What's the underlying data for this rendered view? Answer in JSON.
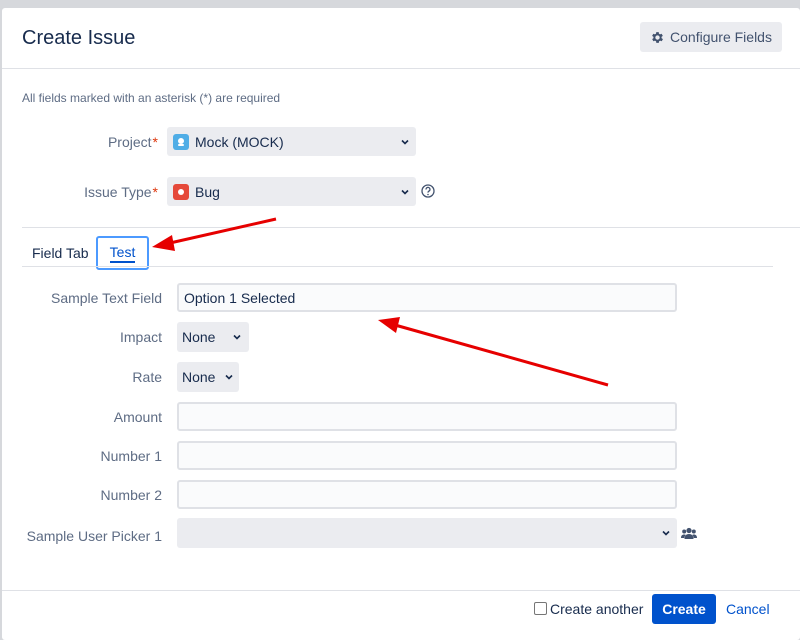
{
  "dialog": {
    "title": "Create Issue",
    "configure_label": "Configure Fields",
    "required_note": "All fields marked with an asterisk (*) are required"
  },
  "project": {
    "label": "Project",
    "required": "*",
    "value": "Mock (MOCK)"
  },
  "issue_type": {
    "label": "Issue Type",
    "required": "*",
    "value": "Bug"
  },
  "tabs": [
    {
      "label": "Field Tab"
    },
    {
      "label": "Test"
    }
  ],
  "fields": {
    "sample_text": {
      "label": "Sample Text Field",
      "value": "Option 1 Selected"
    },
    "impact": {
      "label": "Impact",
      "value": "None"
    },
    "rate": {
      "label": "Rate",
      "value": "None"
    },
    "amount": {
      "label": "Amount",
      "value": ""
    },
    "number1": {
      "label": "Number 1",
      "value": ""
    },
    "number2": {
      "label": "Number 2",
      "value": ""
    },
    "user_picker": {
      "label": "Sample User Picker 1",
      "value": ""
    }
  },
  "footer": {
    "create_another_label": "Create another",
    "create_label": "Create",
    "cancel_label": "Cancel"
  },
  "colors": {
    "accent": "#0052cc",
    "annotation": "#e60000",
    "required": "#de350b",
    "bug": "#e5493a"
  },
  "icons": [
    "gear-icon",
    "project-avatar-icon",
    "bug-icon",
    "help-icon",
    "chevron-down-icon",
    "users-icon"
  ]
}
